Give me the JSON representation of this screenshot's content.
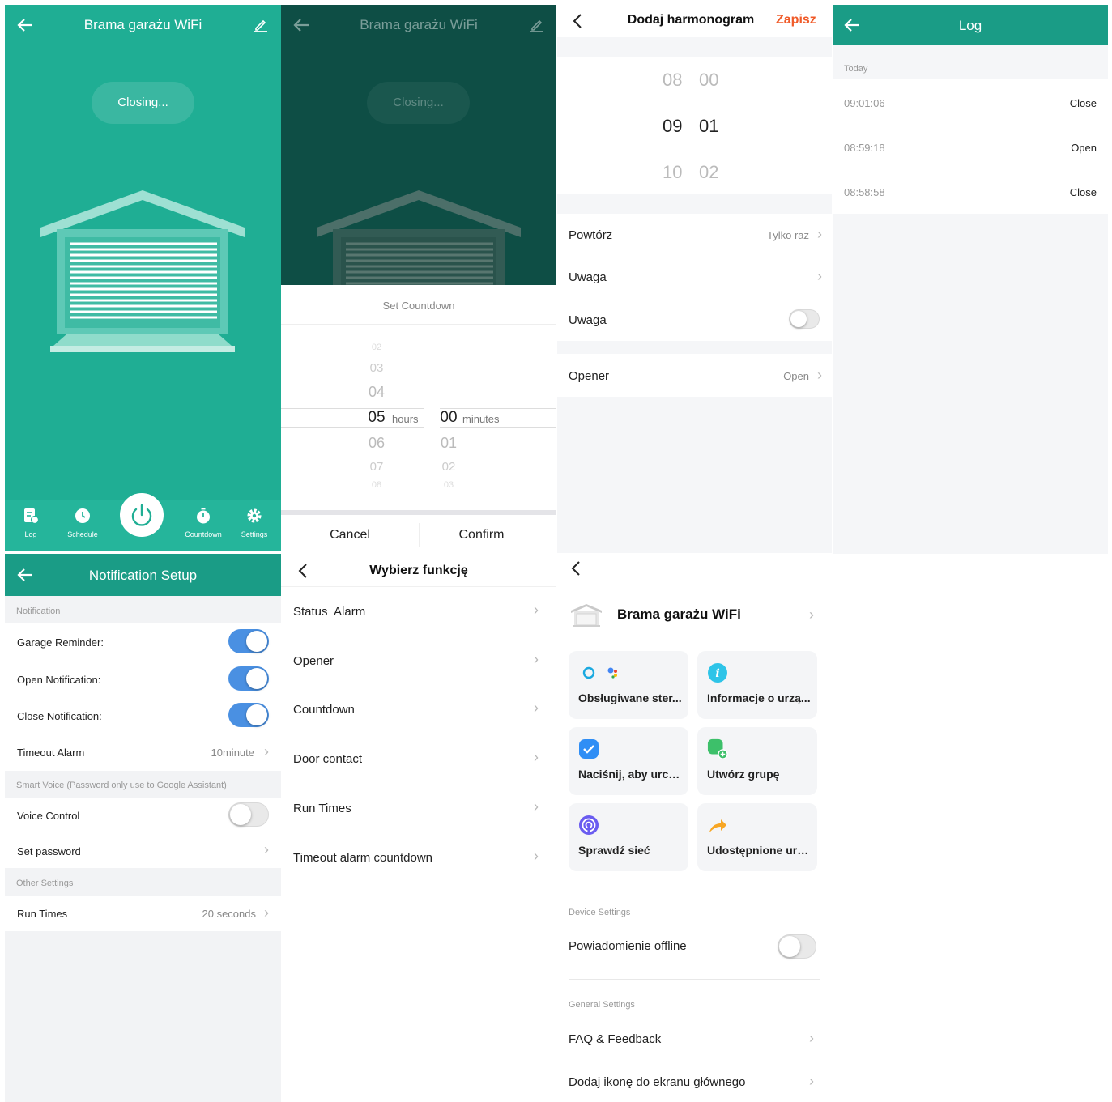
{
  "device_screen": {
    "title": "Brama garażu WiFi",
    "status": "Closing...",
    "nav": {
      "log": "Log",
      "schedule": "Schedule",
      "countdown": "Countdown",
      "settings": "Settings"
    },
    "colors": {
      "primary": "#1fae94",
      "dark": "#0e4e45"
    }
  },
  "countdown_screen": {
    "title": "Brama garażu WiFi",
    "status": "Closing...",
    "panel_title": "Set Countdown",
    "hours_above": [
      "02",
      "03",
      "04"
    ],
    "hours_selected": "05",
    "hours_unit": "hours",
    "hours_below": [
      "06",
      "07",
      "08"
    ],
    "minutes_selected": "00",
    "minutes_unit": "minutes",
    "minutes_below": [
      "01",
      "02",
      "03"
    ],
    "cancel": "Cancel",
    "confirm": "Confirm"
  },
  "schedule_screen": {
    "title": "Dodaj harmonogram",
    "save": "Zapisz",
    "time_rows": [
      {
        "h": "08",
        "m": "00"
      },
      {
        "h": "09",
        "m": "01"
      },
      {
        "h": "10",
        "m": "02"
      }
    ],
    "repeat_label": "Powtórz",
    "repeat_value": "Tylko raz",
    "note_label": "Uwaga",
    "note_toggle_label": "Uwaga",
    "opener_label": "Opener",
    "opener_value": "Open",
    "accent": "#f05a28"
  },
  "log_screen": {
    "title": "Log",
    "section": "Today",
    "entries": [
      {
        "time": "09:01:06",
        "action": "Close"
      },
      {
        "time": "08:59:18",
        "action": "Open"
      },
      {
        "time": "08:58:58",
        "action": "Close"
      }
    ]
  },
  "notification_screen": {
    "title": "Notification Setup",
    "section_notification": "Notification",
    "garage_reminder": "Garage Reminder:",
    "open_notification": "Open Notification:",
    "close_notification": "Close Notification:",
    "timeout_alarm": "Timeout Alarm",
    "timeout_value": "10minute",
    "section_voice": "Smart Voice (Password only use to Google Assistant)",
    "voice_control": "Voice Control",
    "set_password": "Set password",
    "section_other": "Other Settings",
    "run_times": "Run Times",
    "run_times_value": "20 seconds"
  },
  "function_screen": {
    "title": "Wybierz funkcję",
    "items": [
      "Status  Alarm",
      "Opener",
      "Countdown",
      "Door contact",
      "Run Times",
      "Timeout alarm countdown"
    ]
  },
  "device_settings_screen": {
    "device_name": "Brama garażu WiFi",
    "tiles": [
      "Obsługiwane ster...",
      "Informacje o urzą...",
      "Naciśnij, aby urch...",
      "Utwórz grupę",
      "Sprawdź sieć",
      "Udostępnione urz..."
    ],
    "section_device": "Device Settings",
    "offline_notification": "Powiadomienie offline",
    "section_general": "General Settings",
    "faq": "FAQ & Feedback",
    "add_icon": "Dodaj ikonę do ekranu głównego"
  }
}
